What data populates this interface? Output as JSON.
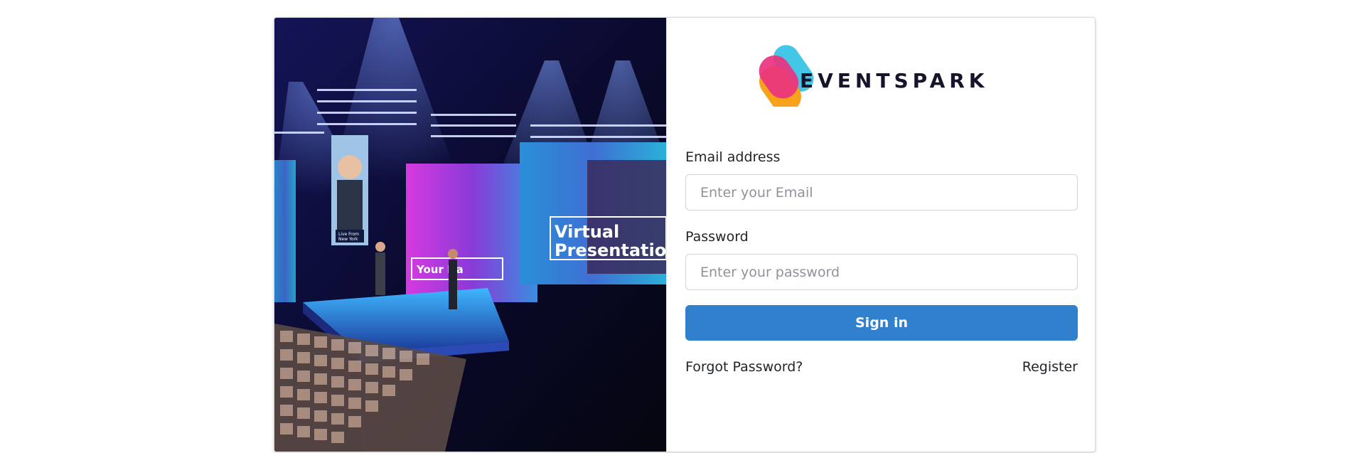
{
  "hero_image": {
    "stage_texts": [
      "Virtual",
      "Presentatio",
      "Your Na",
      "Live From",
      "New York"
    ]
  },
  "brand": {
    "name": "EVENTSPARK",
    "colors": {
      "pink": "#e9337f",
      "orange": "#f7a21b",
      "cyan": "#43c7e6",
      "text": "#14142a"
    }
  },
  "form": {
    "email_label": "Email address",
    "email_placeholder": "Enter your Email",
    "email_value": "",
    "password_label": "Password",
    "password_placeholder": "Enter your password",
    "password_value": "",
    "signin_label": "Sign in",
    "forgot_label": "Forgot Password?",
    "register_label": "Register"
  },
  "colors": {
    "primary": "#3180ce"
  }
}
